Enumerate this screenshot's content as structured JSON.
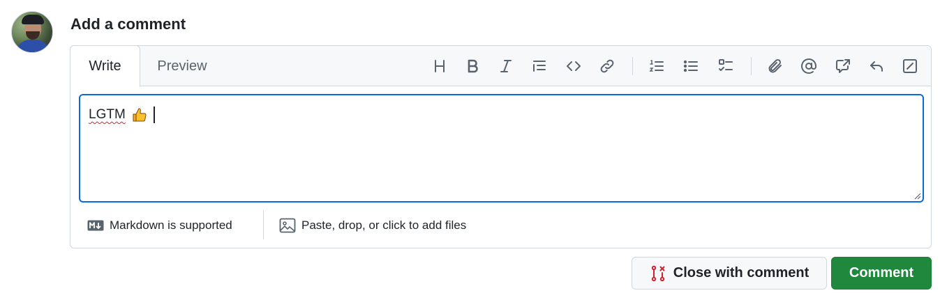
{
  "comment_form": {
    "heading": "Add a comment",
    "tabs": {
      "write": "Write",
      "preview": "Preview"
    },
    "toolbar_icons": [
      "heading-icon",
      "bold-icon",
      "italic-icon",
      "quote-icon",
      "code-icon",
      "link-icon",
      "numbered-list-icon",
      "bullet-list-icon",
      "task-list-icon",
      "attach-icon",
      "mention-icon",
      "reference-icon",
      "saved-replies-icon",
      "fullscreen-icon"
    ],
    "textarea_value": "LGTM",
    "emoji": "👍",
    "footer": {
      "markdown_label": "Markdown is supported",
      "files_label": "Paste, drop, or click to add files"
    },
    "buttons": {
      "close_with_comment": "Close with comment",
      "comment": "Comment"
    },
    "colors": {
      "accent": "#0969da",
      "primary_button": "#1f883d",
      "close_icon": "#cf222e"
    }
  }
}
